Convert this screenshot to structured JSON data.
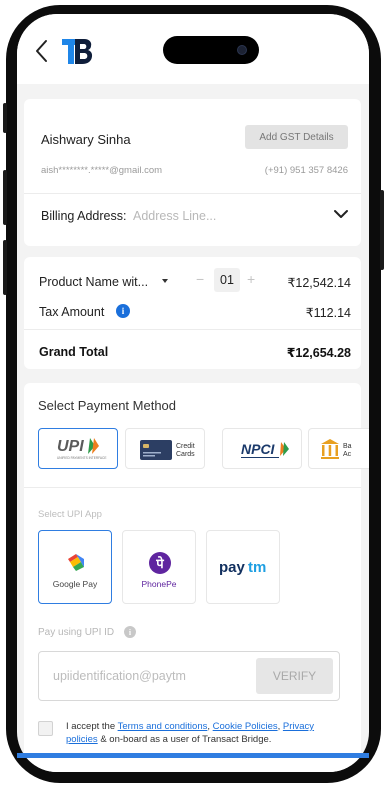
{
  "header": {
    "back_icon": "chevron-left-icon",
    "logo": "TB"
  },
  "customer": {
    "name": "Aishwary Sinha",
    "gst_button": "Add GST Details",
    "email": "aish********.*****@gmail.com",
    "phone": "(+91) 951 357 8426",
    "billing_label": "Billing Address:",
    "billing_placeholder": "Address Line..."
  },
  "order": {
    "product_name": "Product Name wit...",
    "qty_minus": "−",
    "quantity": "01",
    "qty_plus": "+",
    "product_price": "₹12,542.14",
    "tax_label": "Tax Amount",
    "tax_value": "₹112.14",
    "grand_total_label": "Grand Total",
    "grand_total_value": "₹12,654.28"
  },
  "payment": {
    "title": "Select Payment Method",
    "methods": [
      {
        "label": "UPI",
        "sub": "UNIFIED PAYMENTS INTERFACE"
      },
      {
        "label": "Credit Cards"
      },
      {
        "label": "NPCI"
      },
      {
        "label": "Ba Ac"
      }
    ],
    "credit_line1": "Credit",
    "credit_line2": "Cards",
    "bank_line1": "Ba",
    "bank_line2": "Ac",
    "upi_app_title": "Select UPI App",
    "apps": [
      {
        "label": "Google Pay"
      },
      {
        "label": "PhonePe"
      },
      {
        "label": "Paytm"
      }
    ],
    "upi_id_label": "Pay using UPI ID",
    "upi_id_placeholder": "upiidentification@paytm",
    "verify_label": "VERIFY",
    "accept_prefix": "I accept the",
    "terms_link": "Terms and conditions",
    "comma": ",",
    "cookie_link": "Cookie Policies",
    "privacy_link": "Privacy policies",
    "accept_suffix": "& on-board as a user of Transact Bridge."
  },
  "colors": {
    "accent": "#2f7de1",
    "link": "#1a6fdb",
    "background": "#f3f3f3"
  }
}
